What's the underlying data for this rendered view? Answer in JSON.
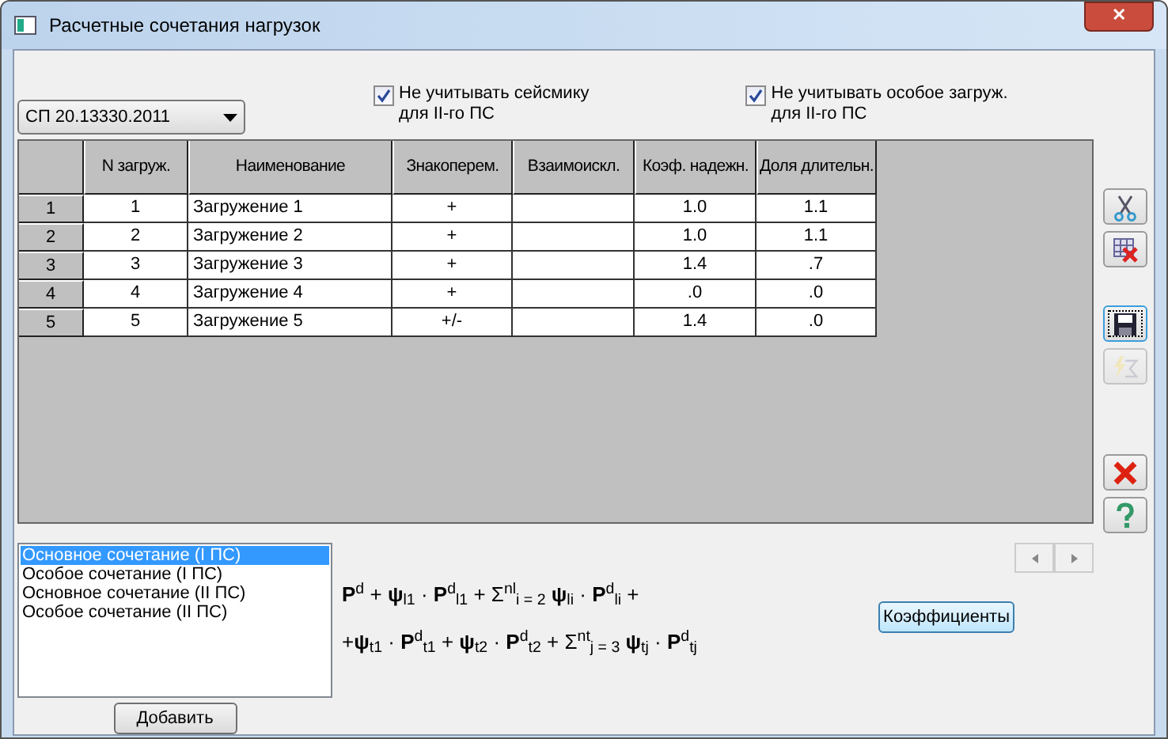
{
  "window": {
    "title": "Расчетные сочетания нагрузок",
    "close": "✕"
  },
  "norm_dropdown": {
    "value": "СП 20.13330.2011"
  },
  "checkboxes": [
    {
      "label": "Не учитывать сейсмику\nдля II-го ПС",
      "checked": true
    },
    {
      "label": "Не учитывать особое загруж.\nдля II-го ПС",
      "checked": true
    }
  ],
  "table": {
    "columns": [
      "N загруж.",
      "Наименование",
      "Знакоперем.",
      "Взаимоискл.",
      "Коэф. надежн.",
      "Доля длительн."
    ],
    "rows": [
      {
        "header": "1",
        "cells": [
          "1",
          "Загружение 1",
          "+",
          "",
          "1.0",
          "1.1"
        ]
      },
      {
        "header": "2",
        "cells": [
          "2",
          "Загружение 2",
          "+",
          "",
          "1.0",
          "1.1"
        ]
      },
      {
        "header": "3",
        "cells": [
          "3",
          "Загружение 3",
          "+",
          "",
          "1.4",
          ".7"
        ]
      },
      {
        "header": "4",
        "cells": [
          "4",
          "Загружение 4",
          "+",
          "",
          ".0",
          ".0"
        ]
      },
      {
        "header": "5",
        "cells": [
          "5",
          "Загружение 5",
          "+/-",
          "",
          "1.4",
          ".0"
        ]
      }
    ]
  },
  "toolbar": [
    {
      "kind": "cut",
      "disabled": false,
      "focused": false
    },
    {
      "kind": "delete-table",
      "disabled": false,
      "focused": false
    },
    {
      "kind": "gap"
    },
    {
      "kind": "save",
      "disabled": false,
      "focused": true
    },
    {
      "kind": "sum",
      "disabled": true,
      "focused": false
    },
    {
      "kind": "gap"
    },
    {
      "kind": "delete",
      "disabled": false,
      "focused": false
    },
    {
      "kind": "help",
      "disabled": false,
      "focused": false
    }
  ],
  "combinations": [
    {
      "label": "Основное сочетание (I ПС)",
      "selected": true
    },
    {
      "label": "Особое сочетание (I ПС)",
      "selected": false
    },
    {
      "label": "Основное сочетание (II ПС)",
      "selected": false
    },
    {
      "label": "Особое сочетание (II ПС)",
      "selected": false
    }
  ],
  "add_button": "Добавить",
  "formula": [
    "**P**$^{d}$ + **ψ**$_{l1}$ · **P**$^{d}$$_{l1}$ + Σ$^{nl}$$_{i = 2}$ **ψ**$_{li}$ · **P**$^{d}$$_{li}$ +",
    "+**ψ**$_{t1}$ · **P**$^{d}$$_{t1}$ + **ψ**$_{t2}$ · **P**$^{d}$$_{t2}$ + Σ$^{nt}$$_{j = 3}$ **ψ**$_{tj}$ · **P**$^{d}$$_{tj}$"
  ],
  "coefficients_button": "Коэффициенты"
}
